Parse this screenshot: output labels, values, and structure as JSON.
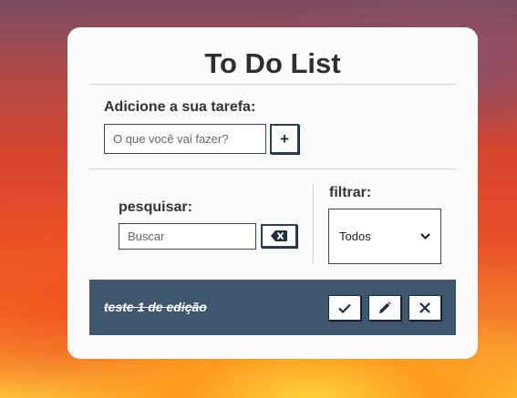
{
  "app": {
    "title": "To Do List"
  },
  "add": {
    "label": "Adicione a sua tarefa:",
    "placeholder": "O que você vai fazer?",
    "button_label": "+"
  },
  "search": {
    "label": "pesquisar:",
    "placeholder": "Buscar",
    "clear_icon": "backspace-icon"
  },
  "filter": {
    "label": "filtrar:",
    "selected": "Todos"
  },
  "todos": [
    {
      "text": "teste 1 de edição",
      "done": true,
      "actions": [
        "check-icon",
        "pencil-icon",
        "close-icon"
      ]
    }
  ],
  "colors": {
    "accent": "#3e566e",
    "card": "#fbfbfb",
    "button_border": "#2c3f55"
  }
}
